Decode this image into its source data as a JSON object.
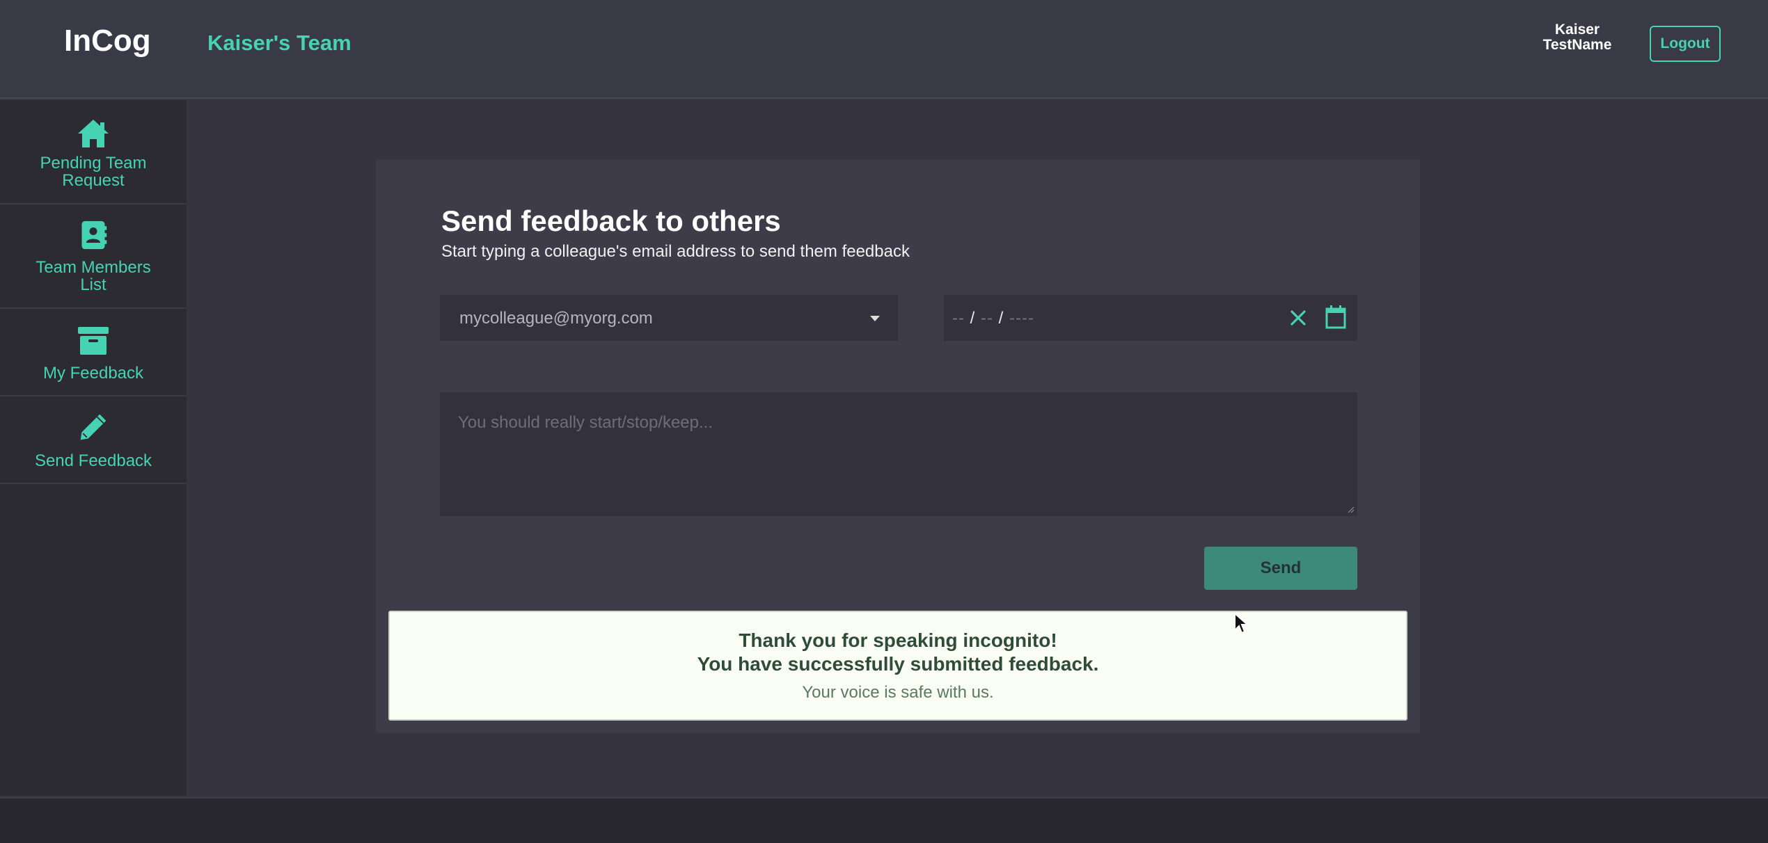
{
  "header": {
    "brand": "InCog",
    "team_title": "Kaiser's Team",
    "user_first": "Kaiser",
    "user_last": "TestName",
    "logout_label": "Logout"
  },
  "sidebar": {
    "items": [
      {
        "icon": "home-icon",
        "line1": "Pending Team",
        "line2": "Request"
      },
      {
        "icon": "address-book-icon",
        "line1": "Team Members",
        "line2": "List"
      },
      {
        "icon": "archive-icon",
        "line1": "My Feedback"
      },
      {
        "icon": "pencil-icon",
        "line1": "Send Feedback"
      }
    ]
  },
  "form": {
    "title": "Send feedback to others",
    "subtitle": "Start typing a colleague's email address to send them feedback",
    "email_value": "mycolleague@myorg.com",
    "date_parts": [
      "--",
      "/",
      "--",
      "/",
      "----"
    ],
    "feedback_placeholder": "You should really start/stop/keep...",
    "send_label": "Send"
  },
  "alert": {
    "line1": "Thank you for speaking incognito!",
    "line2": "You have successfully submitted feedback.",
    "line3": "Your voice is safe with us."
  },
  "colors": {
    "accent": "#45d3b4",
    "send_button": "#3d8a7b",
    "alert_bg": "#fafdf3",
    "background": "#36353f"
  }
}
